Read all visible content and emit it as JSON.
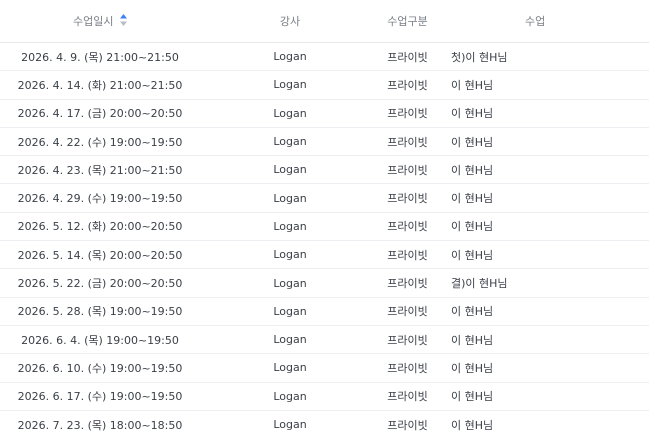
{
  "columns": {
    "date": "수업일시",
    "teacher": "강사",
    "type": "수업구분",
    "class": "수업"
  },
  "rows": [
    {
      "date": "2026. 4. 9. (목) 21:00~21:50",
      "teacher": "Logan",
      "type": "프라이빗",
      "class": "첫)이  현H님"
    },
    {
      "date": "2026. 4. 14. (화) 21:00~21:50",
      "teacher": "Logan",
      "type": "프라이빗",
      "class": "이  현H님"
    },
    {
      "date": "2026. 4. 17. (금) 20:00~20:50",
      "teacher": "Logan",
      "type": "프라이빗",
      "class": "이  현H님"
    },
    {
      "date": "2026. 4. 22. (수) 19:00~19:50",
      "teacher": "Logan",
      "type": "프라이빗",
      "class": "이  현H님"
    },
    {
      "date": "2026. 4. 23. (목) 21:00~21:50",
      "teacher": "Logan",
      "type": "프라이빗",
      "class": "이  현H님"
    },
    {
      "date": "2026. 4. 29. (수) 19:00~19:50",
      "teacher": "Logan",
      "type": "프라이빗",
      "class": "이  현H님"
    },
    {
      "date": "2026. 5. 12. (화) 20:00~20:50",
      "teacher": "Logan",
      "type": "프라이빗",
      "class": "이  현H님"
    },
    {
      "date": "2026. 5. 14. (목) 20:00~20:50",
      "teacher": "Logan",
      "type": "프라이빗",
      "class": "이  현H님"
    },
    {
      "date": "2026. 5. 22. (금) 20:00~20:50",
      "teacher": "Logan",
      "type": "프라이빗",
      "class": "결)이  현H님"
    },
    {
      "date": "2026. 5. 28. (목) 19:00~19:50",
      "teacher": "Logan",
      "type": "프라이빗",
      "class": "이  현H님"
    },
    {
      "date": "2026. 6. 4. (목) 19:00~19:50",
      "teacher": "Logan",
      "type": "프라이빗",
      "class": "이  현H님"
    },
    {
      "date": "2026. 6. 10. (수) 19:00~19:50",
      "teacher": "Logan",
      "type": "프라이빗",
      "class": "이  현H님"
    },
    {
      "date": "2026. 6. 17. (수) 19:00~19:50",
      "teacher": "Logan",
      "type": "프라이빗",
      "class": "이  현H님"
    },
    {
      "date": "2026. 7. 23. (목) 18:00~18:50",
      "teacher": "Logan",
      "type": "프라이빗",
      "class": "이  현H님"
    }
  ],
  "colors": {
    "sort_up": "#3b82f6",
    "sort_down": "#b8bdc6"
  }
}
